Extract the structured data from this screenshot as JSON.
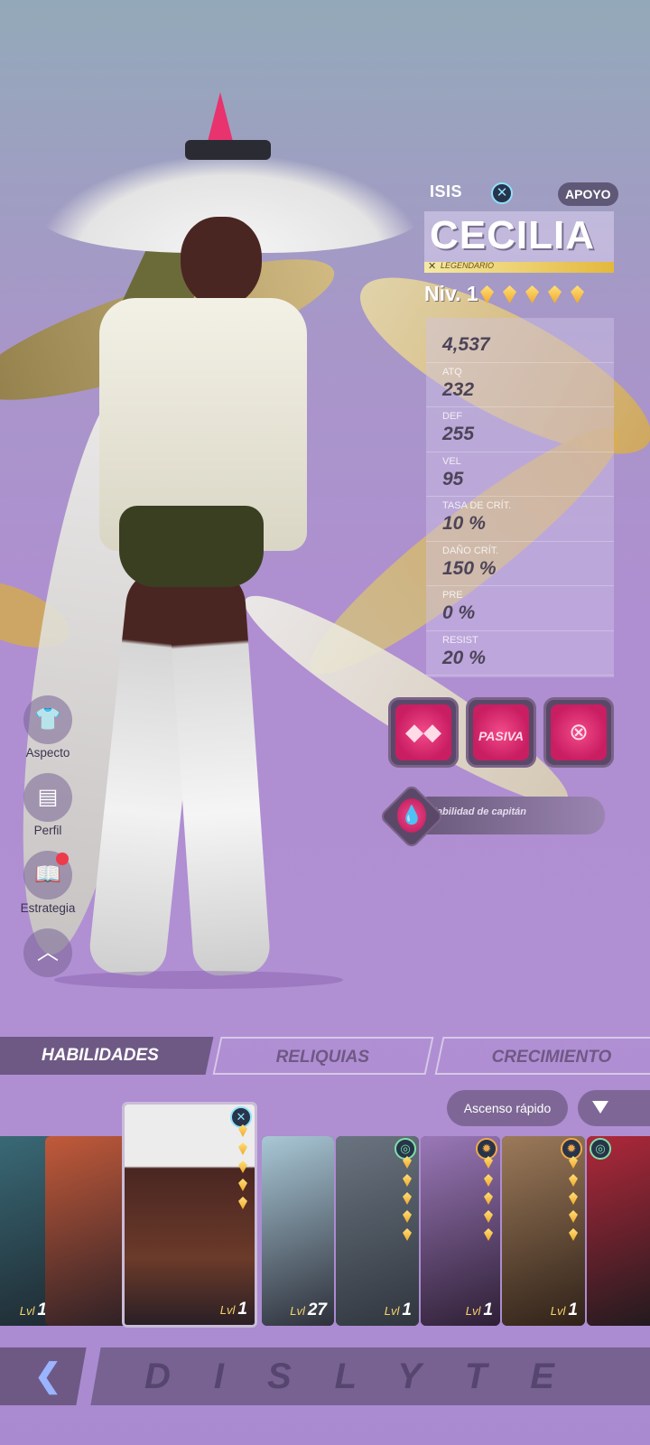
{
  "character": {
    "faction": "ISIS",
    "role": "APOYO",
    "name": "CECILIA",
    "rarity": "LEGENDARIO",
    "level": "Niv. 1",
    "stars": 5
  },
  "stats": [
    {
      "label": "",
      "value": "4,537"
    },
    {
      "label": "ATQ",
      "value": "232"
    },
    {
      "label": "DEF",
      "value": "255"
    },
    {
      "label": "VEL",
      "value": "95"
    },
    {
      "label": "TASA DE CRÍT.",
      "value": "10 %"
    },
    {
      "label": "DAÑO CRÍT.",
      "value": "150 %"
    },
    {
      "label": "PRE",
      "value": "0 %"
    },
    {
      "label": "RESIST",
      "value": "20 %"
    }
  ],
  "skills": {
    "skill1_icon": "diamonds-skill-icon",
    "passive_label": "PASIVA",
    "skill3_icon": "crosshair-skill-icon",
    "captain_label": "Habilidad de capitán"
  },
  "side_menu": [
    {
      "label": "Aspecto",
      "icon": "shirt-icon"
    },
    {
      "label": "Perfil",
      "icon": "id-card-icon"
    },
    {
      "label": "Estrategia",
      "icon": "book-icon"
    }
  ],
  "tabs": [
    "HABILIDADES",
    "RELIQUIAS",
    "CRECIMIENTO"
  ],
  "ascend_button": "Ascenso rápido",
  "roster": [
    {
      "level": "1",
      "prefix": "Lvl",
      "bg": "#3a6b78"
    },
    {
      "level": "",
      "prefix": "",
      "bg": "#7a2f2a"
    },
    {
      "level": "1",
      "prefix": "Lvl",
      "bg": "#4a2c22"
    },
    {
      "level": "27",
      "prefix": "Lvl",
      "bg": "#3a3f4e"
    },
    {
      "level": "1",
      "prefix": "Lvl",
      "bg": "#4b5560"
    },
    {
      "level": "1",
      "prefix": "Lvl",
      "bg": "#5a3a6a"
    },
    {
      "level": "1",
      "prefix": "Lvl",
      "bg": "#5a3c2a"
    },
    {
      "level": "",
      "prefix": "",
      "bg": "#6a2226"
    }
  ],
  "brand": "DISLYTE",
  "colors": {
    "accent_pink": "#e8336e",
    "tab_active": "#6e5985",
    "gold": "#f0a92a"
  }
}
